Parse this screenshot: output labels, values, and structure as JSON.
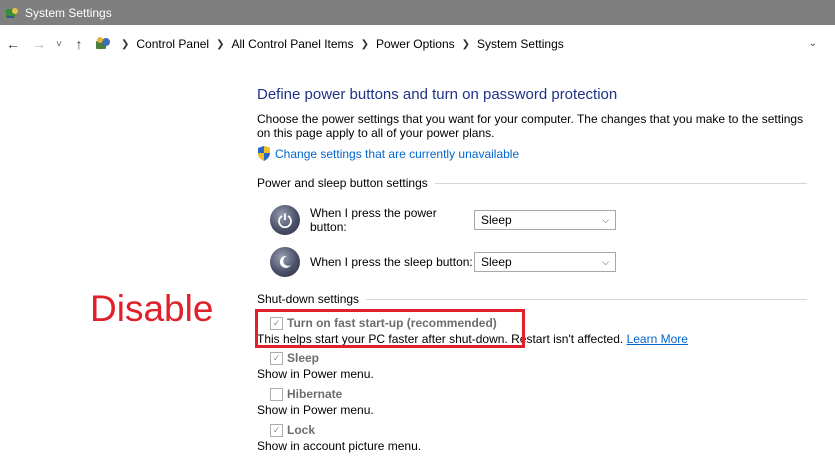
{
  "window": {
    "title": "System Settings"
  },
  "address_bar": {
    "back": "←",
    "forward": "→",
    "recent": "˅",
    "up": "↑",
    "breadcrumbs": [
      "Control Panel",
      "All Control Panel Items",
      "Power Options",
      "System Settings"
    ],
    "dropdown": "⌄"
  },
  "main": {
    "heading": "Define power buttons and turn on password protection",
    "description": "Choose the power settings that you want for your computer. The changes that you make to the settings on this page apply to all of your power plans.",
    "change_link": "Change settings that are currently unavailable",
    "power_section": {
      "title": "Power and sleep button settings",
      "rows": [
        {
          "label": "When I press the power button:",
          "value": "Sleep"
        },
        {
          "label": "When I press the sleep button:",
          "value": "Sleep"
        }
      ]
    },
    "shutdown_section": {
      "title": "Shut-down settings",
      "options": [
        {
          "label": "Turn on fast start-up (recommended)",
          "checked": true,
          "desc_before": "This helps start your PC faster after shut-down. Restart isn't affected.",
          "link": "Learn More"
        },
        {
          "label": "Sleep",
          "checked": true,
          "desc": "Show in Power menu."
        },
        {
          "label": "Hibernate",
          "checked": false,
          "desc": "Show in Power menu."
        },
        {
          "label": "Lock",
          "checked": true,
          "desc": "Show in account picture menu."
        }
      ]
    }
  },
  "annotation": {
    "text": "Disable",
    "color": "#e0202a"
  },
  "colors": {
    "heading": "#1e3287",
    "link": "#0066cc",
    "titlebar": "#7f7f7f"
  }
}
